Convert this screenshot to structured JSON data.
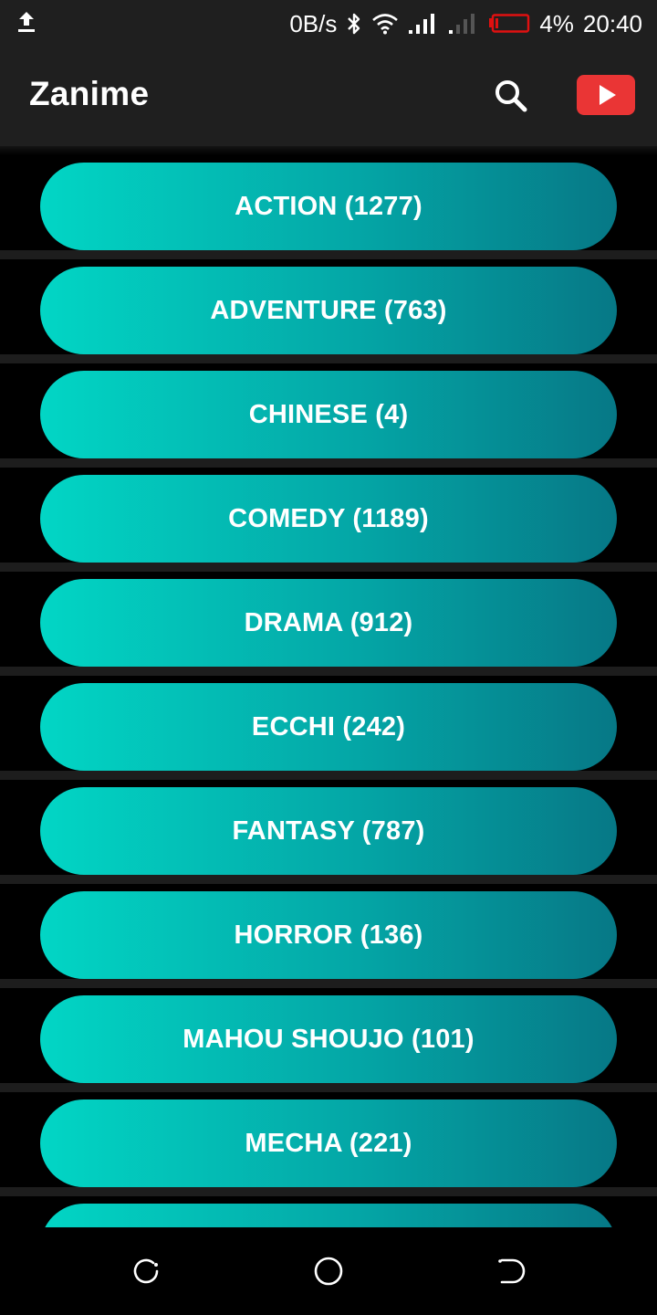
{
  "status_bar": {
    "network_speed": "0B/s",
    "battery": "4%",
    "time": "20:40",
    "icons": [
      "upload-icon",
      "bluetooth-icon",
      "wifi-icon",
      "signal-icon",
      "signal-weak-icon",
      "battery-low-icon"
    ],
    "battery_color": "#e01010"
  },
  "app_bar": {
    "title": "Zanime",
    "search_icon": "search-icon",
    "youtube_icon": "youtube-play-icon",
    "youtube_color": "#ea3535"
  },
  "genres": [
    {
      "label": "ACTION (1277)"
    },
    {
      "label": "ADVENTURE (763)"
    },
    {
      "label": "CHINESE (4)"
    },
    {
      "label": "COMEDY (1189)"
    },
    {
      "label": "DRAMA (912)"
    },
    {
      "label": "ECCHI (242)"
    },
    {
      "label": "FANTASY (787)"
    },
    {
      "label": "HORROR (136)"
    },
    {
      "label": "MAHOU SHOUJO (101)"
    },
    {
      "label": "MECHA (221)"
    },
    {
      "label": ""
    }
  ],
  "theme": {
    "button_gradient_start": "#02d6c5",
    "button_gradient_end": "#067886",
    "app_bar_bg": "#1f1f1f"
  },
  "nav_bar": {
    "icons": [
      "recent-apps-icon",
      "home-icon",
      "back-icon"
    ]
  }
}
